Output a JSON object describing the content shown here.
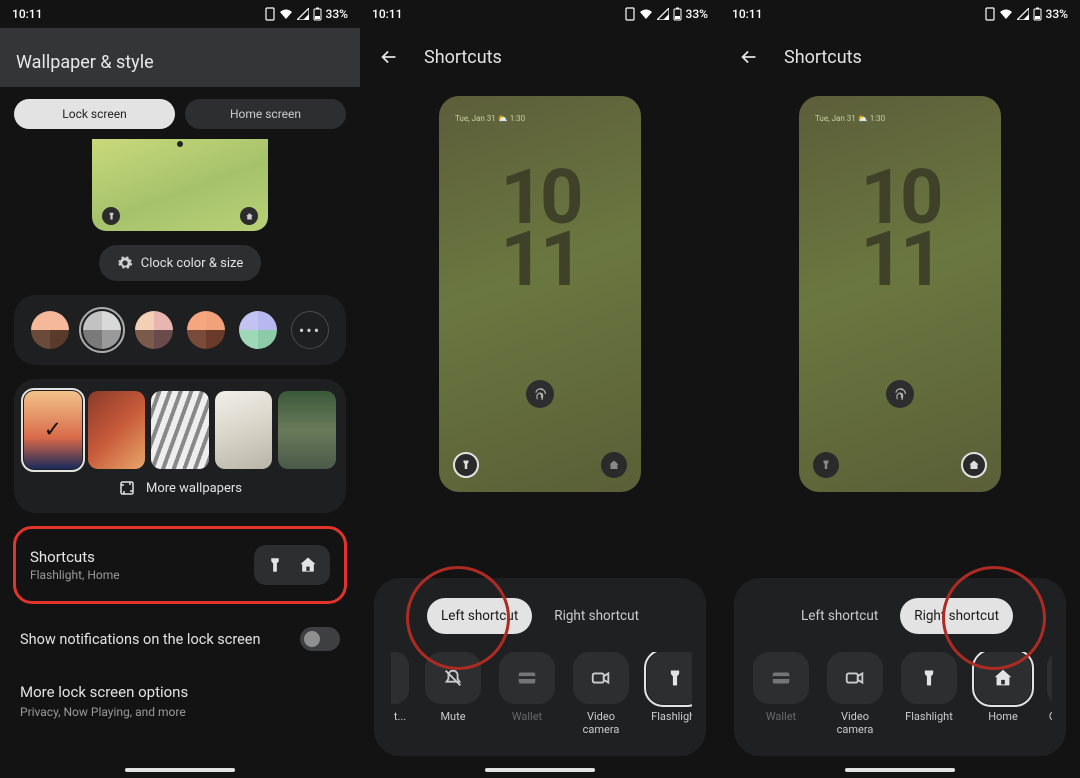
{
  "status": {
    "time": "10:11",
    "battery": "33%"
  },
  "s1": {
    "title": "Wallpaper & style",
    "tabs": {
      "lock": "Lock screen",
      "home": "Home screen"
    },
    "clock_chip": "Clock color & size",
    "more_wallpapers": "More wallpapers",
    "shortcuts": {
      "title": "Shortcuts",
      "subtitle": "Flashlight, Home"
    },
    "notif_label": "Show notifications on the lock screen",
    "more_opts": {
      "title": "More lock screen options",
      "subtitle": "Privacy, Now Playing, and more"
    }
  },
  "s2": {
    "title": "Shortcuts",
    "tabs": {
      "left": "Left shortcut",
      "right": "Right shortcut"
    },
    "preview_time": "10\n11",
    "preview_date": "Tue, Jan 31  ⛅ 1:30",
    "opts": {
      "mute": "Mute",
      "wallet": "Wallet",
      "video": "Video camera",
      "flash": "Flashlight",
      "home": "Home",
      "qr": "QR",
      "partial": "t..."
    }
  }
}
